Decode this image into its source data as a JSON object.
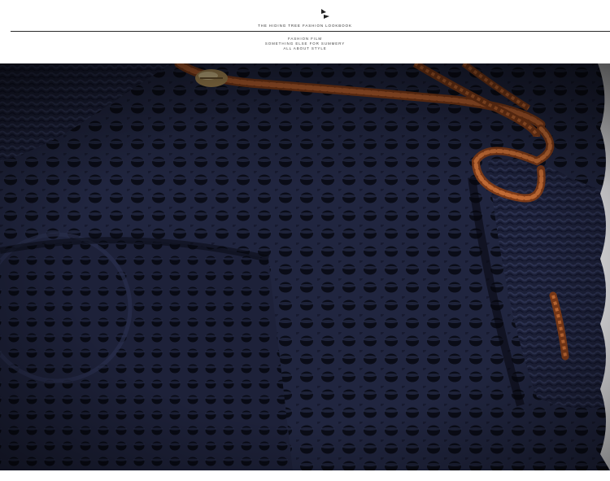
{
  "header": {
    "brand": "THE HIDING TREE FASHION LOOKBOOK",
    "tagline": [
      "FASHION FILM",
      "SOMETHING ELSE FOR SUMMERY",
      "ALL ABOUT STYLE"
    ],
    "logo_icon": "bowtie-logo-icon"
  },
  "photo": {
    "subject": "navy crochet knit with braided brown leather cord",
    "colors": {
      "knit": "#1f2440",
      "shadow": "#0b0d18",
      "cord": "#9a4b24"
    }
  }
}
